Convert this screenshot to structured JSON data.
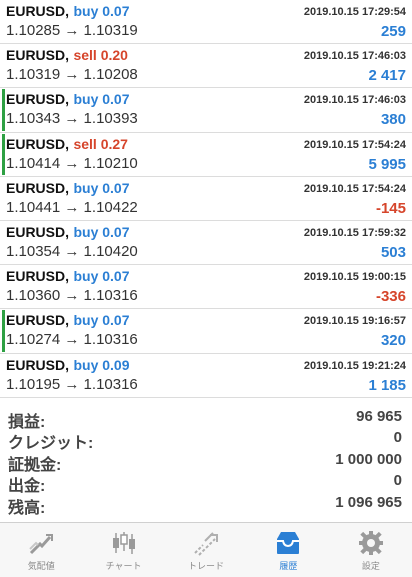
{
  "trades": [
    {
      "symbol": "EURUSD,",
      "side": "buy",
      "side_label": "buy 0.07",
      "time": "2019.10.15 17:29:54",
      "prices": "1.10285 → 1.10319",
      "profit": "259",
      "profit_sign": "pos",
      "marked": false
    },
    {
      "symbol": "EURUSD,",
      "side": "sell",
      "side_label": "sell 0.20",
      "time": "2019.10.15 17:46:03",
      "prices": "1.10319 → 1.10208",
      "profit": "2 417",
      "profit_sign": "pos",
      "marked": false
    },
    {
      "symbol": "EURUSD,",
      "side": "buy",
      "side_label": "buy 0.07",
      "time": "2019.10.15 17:46:03",
      "prices": "1.10343 → 1.10393",
      "profit": "380",
      "profit_sign": "pos",
      "marked": true
    },
    {
      "symbol": "EURUSD,",
      "side": "sell",
      "side_label": "sell 0.27",
      "time": "2019.10.15 17:54:24",
      "prices": "1.10414 → 1.10210",
      "profit": "5 995",
      "profit_sign": "pos",
      "marked": true
    },
    {
      "symbol": "EURUSD,",
      "side": "buy",
      "side_label": "buy 0.07",
      "time": "2019.10.15 17:54:24",
      "prices": "1.10441 → 1.10422",
      "profit": "-145",
      "profit_sign": "neg",
      "marked": false
    },
    {
      "symbol": "EURUSD,",
      "side": "buy",
      "side_label": "buy 0.07",
      "time": "2019.10.15 17:59:32",
      "prices": "1.10354 → 1.10420",
      "profit": "503",
      "profit_sign": "pos",
      "marked": false
    },
    {
      "symbol": "EURUSD,",
      "side": "buy",
      "side_label": "buy 0.07",
      "time": "2019.10.15 19:00:15",
      "prices": "1.10360 → 1.10316",
      "profit": "-336",
      "profit_sign": "neg",
      "marked": false
    },
    {
      "symbol": "EURUSD,",
      "side": "buy",
      "side_label": "buy 0.07",
      "time": "2019.10.15 19:16:57",
      "prices": "1.10274 → 1.10316",
      "profit": "320",
      "profit_sign": "pos",
      "marked": true
    },
    {
      "symbol": "EURUSD,",
      "side": "buy",
      "side_label": "buy 0.09",
      "time": "2019.10.15 19:21:24",
      "prices": "1.10195 → 1.10316",
      "profit": "1 185",
      "profit_sign": "pos",
      "marked": false
    }
  ],
  "summary": [
    {
      "label": "損益:",
      "value": "96 965"
    },
    {
      "label": "クレジット:",
      "value": "0"
    },
    {
      "label": "証拠金:",
      "value": "1 000 000"
    },
    {
      "label": "出金:",
      "value": "0"
    },
    {
      "label": "残高:",
      "value": "1 096 965"
    }
  ],
  "tabs": [
    {
      "label": "気配値",
      "icon": "quotes-icon",
      "active": false
    },
    {
      "label": "チャート",
      "icon": "chart-icon",
      "active": false
    },
    {
      "label": "トレード",
      "icon": "trade-icon",
      "active": false
    },
    {
      "label": "履歴",
      "icon": "history-icon",
      "active": true
    },
    {
      "label": "設定",
      "icon": "settings-icon",
      "active": false
    }
  ],
  "colors": {
    "buy": "#2b7fd4",
    "sell": "#d6452b",
    "marker": "#2ea043",
    "active_tab": "#2b7fd4"
  }
}
